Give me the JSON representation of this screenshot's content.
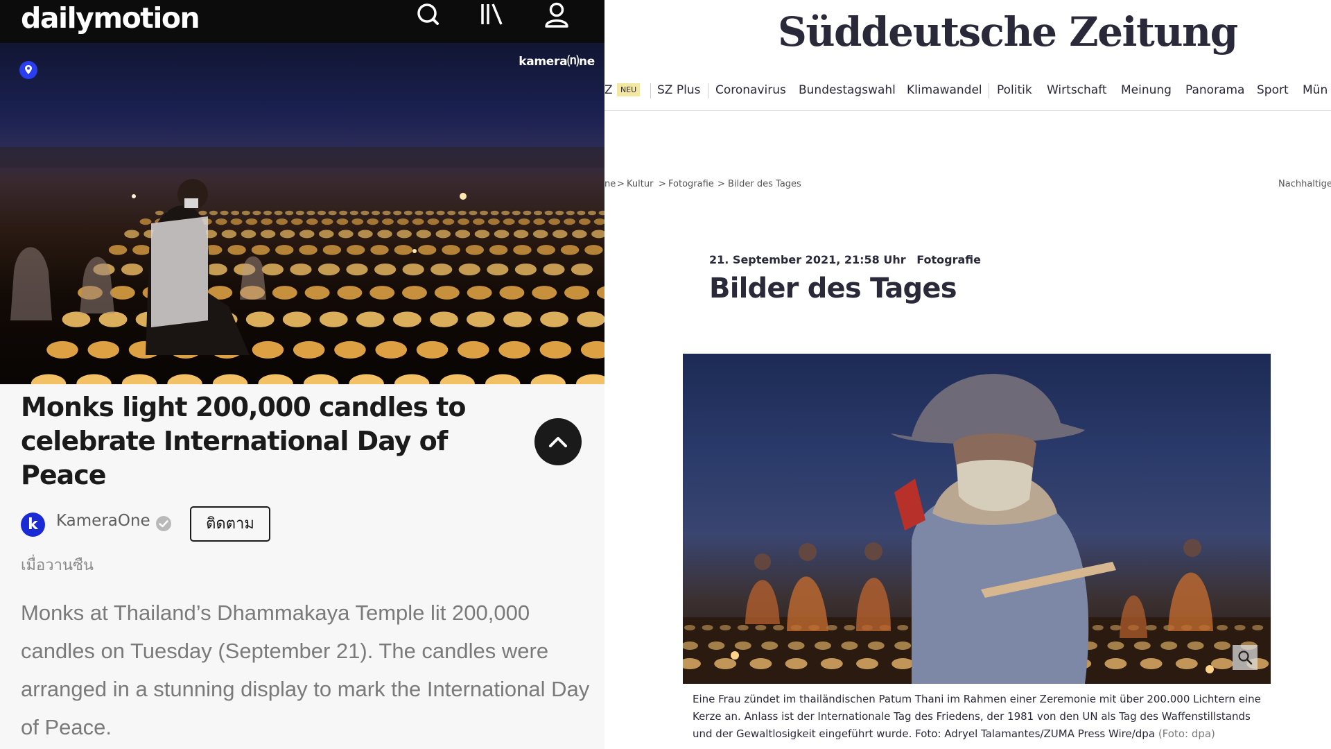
{
  "dailymotion": {
    "logo": "dailymotion",
    "watermark": "kamera⒩ne",
    "title": "Monks light 200,000 candles to celebrate International Day of Peace",
    "channel": {
      "avatar_letter": "k",
      "name": "KameraOne",
      "follow_label": "ติดตาม"
    },
    "posted": "เมื่อวานซืน",
    "description": "Monks at Thailand’s Dhammakaya Temple lit 200,000 candles on Tuesday (September 21). The candles were arranged in a stunning display to mark the International Day of Peace.",
    "icons": [
      "search-icon",
      "library-icon",
      "user-icon",
      "location-pin-icon",
      "chevron-up-icon",
      "verified-icon"
    ],
    "colors": {
      "topbar": "#0c0c0c",
      "avatar": "#1a2bd6",
      "background": "#f7f7f7"
    }
  },
  "sz": {
    "logo": "Süddeutsche Zeitung",
    "nav": {
      "partial_first": "Z",
      "neu_badge": "NEU",
      "items": [
        "SZ Plus",
        "Coronavirus",
        "Bundestagswahl",
        "Klimawandel",
        "Politik",
        "Wirtschaft",
        "Meinung",
        "Panorama",
        "Sport",
        "Mün"
      ]
    },
    "breadcrumb": {
      "items": [
        "ne",
        "Kultur",
        "Fotografie",
        "Bilder des Tages"
      ],
      "separator": ">",
      "right_link": "Nachhaltige"
    },
    "article": {
      "date": "21. September 2021, 21:58 Uhr",
      "category": "Fotografie",
      "headline": "Bilder des Tages",
      "caption": "Eine Frau zündet im thailändischen Patum Thani im Rahmen einer Zeremonie mit über 200.000 Lichtern eine Kerze an. Anlass ist der Internationale Tag des Friedens, der 1981 von den UN als Tag des Waffenstillstands und der Gewaltlosigkeit eingeführt wurde. Foto: Adryel Talamantes/ZUMA Press Wire/dpa",
      "caption_credit": "(Foto: dpa)"
    },
    "colors": {
      "text": "#29293a",
      "neu_badge": "#f3e7a2"
    }
  }
}
